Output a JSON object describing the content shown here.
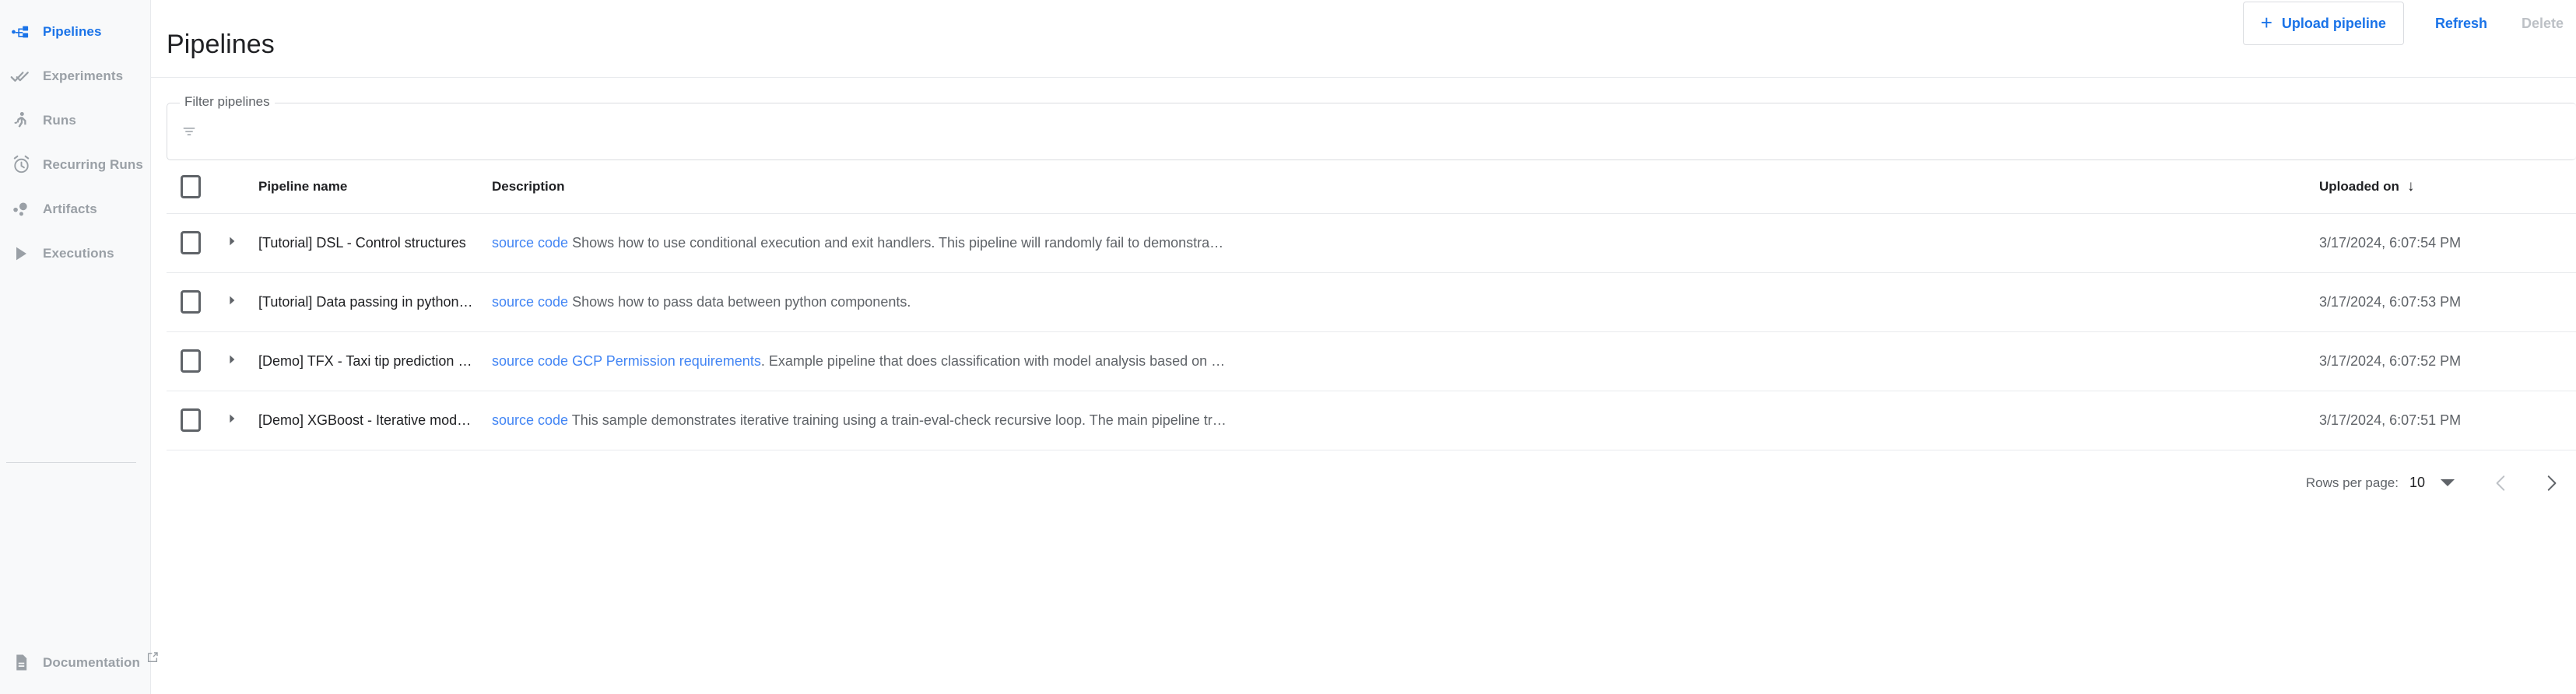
{
  "sidebar": {
    "items": [
      {
        "label": "Pipelines",
        "icon": "pipelines-icon",
        "active": true,
        "external": false
      },
      {
        "label": "Experiments",
        "icon": "experiments-icon",
        "active": false,
        "external": false
      },
      {
        "label": "Runs",
        "icon": "runs-icon",
        "active": false,
        "external": false
      },
      {
        "label": "Recurring Runs",
        "icon": "recurring-runs-icon",
        "active": false,
        "external": false
      },
      {
        "label": "Artifacts",
        "icon": "artifacts-icon",
        "active": false,
        "external": false
      },
      {
        "label": "Executions",
        "icon": "executions-icon",
        "active": false,
        "external": false
      }
    ],
    "bottom": {
      "label": "Documentation",
      "icon": "documentation-icon",
      "external_icon": "external-link-icon"
    }
  },
  "header": {
    "title": "Pipelines",
    "upload_label": "Upload pipeline",
    "upload_plus": "+",
    "refresh_label": "Refresh",
    "delete_label": "Delete"
  },
  "filter": {
    "legend": "Filter pipelines",
    "value": "",
    "placeholder": "",
    "icon": "filter-icon"
  },
  "table": {
    "columns": {
      "pipeline_name": "Pipeline name",
      "description": "Description",
      "uploaded_on": "Uploaded on",
      "sort_arrow": "↓"
    },
    "select_all_checked": false,
    "rows": [
      {
        "name": "[Tutorial] DSL - Control structures",
        "links": [
          "source code"
        ],
        "description": " Shows how to use conditional execution and exit handlers. This pipeline will randomly fail to demonstra…",
        "uploaded_on": "3/17/2024, 6:07:54 PM",
        "checked": false
      },
      {
        "name": "[Tutorial] Data passing in python com…",
        "links": [
          "source code"
        ],
        "description": " Shows how to pass data between python components.",
        "uploaded_on": "3/17/2024, 6:07:53 PM",
        "checked": false
      },
      {
        "name": "[Demo] TFX - Taxi tip prediction mod…",
        "links": [
          "source code",
          "GCP Permission requirements"
        ],
        "description": ". Example pipeline that does classification with model analysis based on …",
        "uploaded_on": "3/17/2024, 6:07:52 PM",
        "checked": false
      },
      {
        "name": "[Demo] XGBoost - Iterative model tra…",
        "links": [
          "source code"
        ],
        "description": " This sample demonstrates iterative training using a train-eval-check recursive loop. The main pipeline tr…",
        "uploaded_on": "3/17/2024, 6:07:51 PM",
        "checked": false
      }
    ]
  },
  "pagination": {
    "rows_per_page_label": "Rows per page:",
    "rows_per_page_value": "10",
    "prev_icon": "chevron-left-icon",
    "next_icon": "chevron-right-icon"
  },
  "colors": {
    "accent": "#1a73e8",
    "link": "#4285f4",
    "text": "#202124",
    "muted": "#5f6368",
    "disabled": "#bdc1c6",
    "border": "#e8eaed",
    "sidebar_bg": "#f8f9fa"
  }
}
